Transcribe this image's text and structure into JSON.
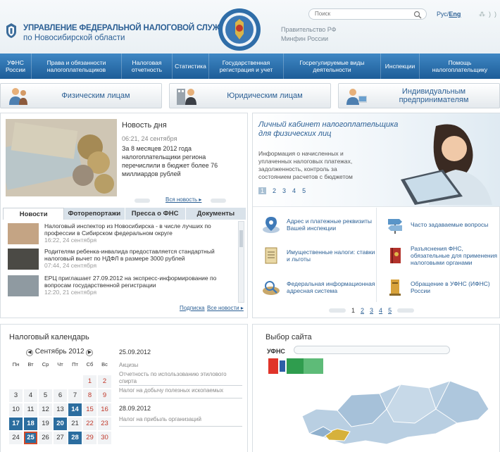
{
  "header": {
    "title_line1": "УПРАВЛЕНИЕ ФЕДЕРАЛЬНОЙ НАЛОГОВОЙ СЛУЖБЫ",
    "title_line2": "по Новосибирской области",
    "gov_link1": "Правительство РФ",
    "gov_link2": "Минфин России",
    "search_placeholder": "Поиск",
    "lang_ru": "Рус/",
    "lang_en": "Eng"
  },
  "nav": [
    {
      "label": "УФНС России"
    },
    {
      "label": "Права и обязанности налогоплательщиков"
    },
    {
      "label": "Налоговая отчетность"
    },
    {
      "label": "Статистика"
    },
    {
      "label": "Государственная регистрация и учет"
    },
    {
      "label": "Госрегулируемые виды деятельности"
    },
    {
      "label": "Инспекции"
    },
    {
      "label": "Помощь налогоплательщику"
    }
  ],
  "categories": {
    "individuals": "Физическим лицам",
    "legal": "Юридическим лицам",
    "entrepreneurs": "Индивидуальным предпринимателям"
  },
  "news_day": {
    "title": "Новость дня",
    "time": "06:21, 24 сентября",
    "text": "За 8 месяцев 2012 года налогоплательщики региона перечислили в бюджет более 76 миллиардов рублей",
    "all_news": "Вся новость ▸"
  },
  "tabs": [
    "Новости",
    "Фоторепортажи",
    "Пресса о ФНС",
    "Документы"
  ],
  "news_list": [
    {
      "title": "Налоговый инспектор из Новосибирска - в числе лучших по профессии в Сибирском федеральном округе",
      "date": "16:22, 24 сентября"
    },
    {
      "title": "Родителям ребенка-инвалида предоставляется стандартный налоговый вычет по НДФЛ в размере 3000 рублей",
      "date": "07:44, 24 сентября"
    },
    {
      "title": "ЕРЦ приглашает 27.09.2012 на экспресс-информирование по вопросам государственной регистрации",
      "date": "12:20, 21 сентября"
    }
  ],
  "news_footer": {
    "subscribe": "Подписка",
    "all": "Все новости ▸"
  },
  "cabinet": {
    "title": "Личный кабинет налогоплательщика для физических лиц",
    "text": "Информация о начисленных и уплаченных налоговых платежах, задолженность, контроль за состоянием расчетов с бюджетом",
    "pages": [
      "1",
      "2",
      "3",
      "4",
      "5"
    ]
  },
  "services": [
    {
      "label": "Адрес и платежные реквизиты Вашей инспекции"
    },
    {
      "label": "Часто задаваемые вопросы"
    },
    {
      "label": "Имущественные налоги: ставки и льготы"
    },
    {
      "label": "Разъяснения ФНС, обязательные для применения налоговыми органами"
    },
    {
      "label": "Федеральная информационная адресная система"
    },
    {
      "label": "Обращение в УФНС (ИФНС) России"
    }
  ],
  "services_pages": [
    "1",
    "2",
    "3",
    "4",
    "5"
  ],
  "calendar": {
    "title": "Налоговый календарь",
    "month": "Сентябрь 2012",
    "weekdays": [
      "Пн",
      "Вт",
      "Ср",
      "Чт",
      "Пт",
      "Сб",
      "Вс"
    ],
    "rows": [
      [
        "",
        "",
        "",
        "",
        "",
        "1",
        "2"
      ],
      [
        "3",
        "4",
        "5",
        "6",
        "7",
        "8",
        "9"
      ],
      [
        "10",
        "11",
        "12",
        "13",
        "14",
        "15",
        "16"
      ],
      [
        "17",
        "18",
        "19",
        "20",
        "21",
        "22",
        "23"
      ],
      [
        "24",
        "25",
        "26",
        "27",
        "28",
        "29",
        "30"
      ]
    ],
    "events": [
      {
        "date": "25.09.2012",
        "items": [
          "Акцизы",
          "Отчетность по использованию этилового спирта",
          "Налог на добычу полезных ископаемых"
        ]
      },
      {
        "date": "28.09.2012",
        "items": [
          "Налог на прибыль организаций"
        ]
      }
    ]
  },
  "site_select": {
    "title": "Выбор сайта",
    "label": "УФНС"
  },
  "colors": {
    "nav": "#2b6fad",
    "accent": "#2b5f94",
    "highlight": "#2b6d9f"
  }
}
